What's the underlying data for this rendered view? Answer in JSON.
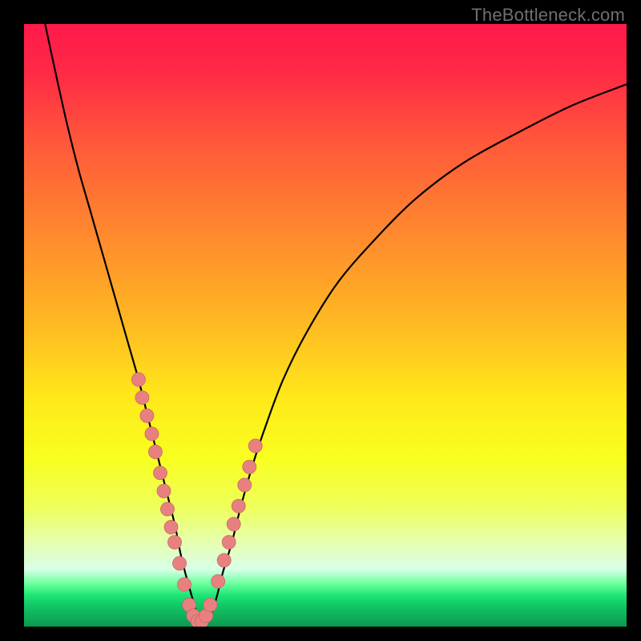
{
  "watermark": "TheBottleneck.com",
  "colors": {
    "frame": "#000000",
    "curve": "#000000",
    "dot_fill": "#e98080",
    "dot_stroke": "#c26a6a",
    "gradient_stops": [
      {
        "offset": 0,
        "color": "#ff1a4b"
      },
      {
        "offset": 0.08,
        "color": "#ff2a46"
      },
      {
        "offset": 0.2,
        "color": "#ff5a3a"
      },
      {
        "offset": 0.35,
        "color": "#ff8a2e"
      },
      {
        "offset": 0.5,
        "color": "#ffbb22"
      },
      {
        "offset": 0.62,
        "color": "#ffe91a"
      },
      {
        "offset": 0.72,
        "color": "#f9ff20"
      },
      {
        "offset": 0.8,
        "color": "#efff5a"
      },
      {
        "offset": 0.86,
        "color": "#e6ffb0"
      },
      {
        "offset": 0.905,
        "color": "#d8ffe8"
      },
      {
        "offset": 0.93,
        "color": "#66ff99"
      },
      {
        "offset": 0.948,
        "color": "#1ee676"
      },
      {
        "offset": 0.965,
        "color": "#12c766"
      },
      {
        "offset": 1.0,
        "color": "#0a9a50"
      }
    ]
  },
  "chart_data": {
    "type": "line",
    "title": "",
    "xlabel": "",
    "ylabel": "",
    "grid": false,
    "legend": false,
    "xlim": [
      0,
      100
    ],
    "ylim": [
      0,
      100
    ],
    "series": [
      {
        "name": "bottleneck-curve",
        "x": [
          3.5,
          5,
          7,
          9,
          11,
          13,
          15,
          17,
          19,
          20.5,
          22,
          23.5,
          25,
          26,
          27,
          28,
          28.7,
          29.3,
          30,
          31,
          32,
          33,
          34.5,
          36,
          38,
          40,
          43,
          47,
          52,
          58,
          65,
          73,
          82,
          91,
          100
        ],
        "y": [
          100,
          93,
          84,
          76,
          69,
          62,
          55,
          48,
          41,
          35,
          29,
          23,
          17,
          12,
          8,
          4.5,
          2,
          0.8,
          0.8,
          2,
          5,
          9,
          14,
          20,
          27,
          33,
          41,
          49,
          57,
          64,
          71,
          77,
          82,
          86.5,
          90
        ]
      }
    ],
    "markers": [
      {
        "name": "left-branch-dots",
        "x": [
          19.0,
          19.6,
          20.4,
          21.2,
          21.8,
          22.6,
          23.2,
          23.8,
          24.4,
          25.0,
          25.8,
          26.6
        ],
        "y": [
          41.0,
          38.0,
          35.0,
          32.0,
          29.0,
          25.5,
          22.5,
          19.5,
          16.5,
          14.0,
          10.5,
          7.0
        ]
      },
      {
        "name": "valley-dots",
        "x": [
          27.4,
          28.1,
          28.8,
          29.5,
          30.2,
          30.9
        ],
        "y": [
          3.6,
          1.8,
          0.9,
          0.9,
          1.8,
          3.6
        ]
      },
      {
        "name": "right-branch-dots",
        "x": [
          32.2,
          33.2,
          34.0,
          34.8,
          35.6,
          36.6,
          37.4,
          38.4
        ],
        "y": [
          7.5,
          11.0,
          14.0,
          17.0,
          20.0,
          23.5,
          26.5,
          30.0
        ]
      }
    ]
  }
}
